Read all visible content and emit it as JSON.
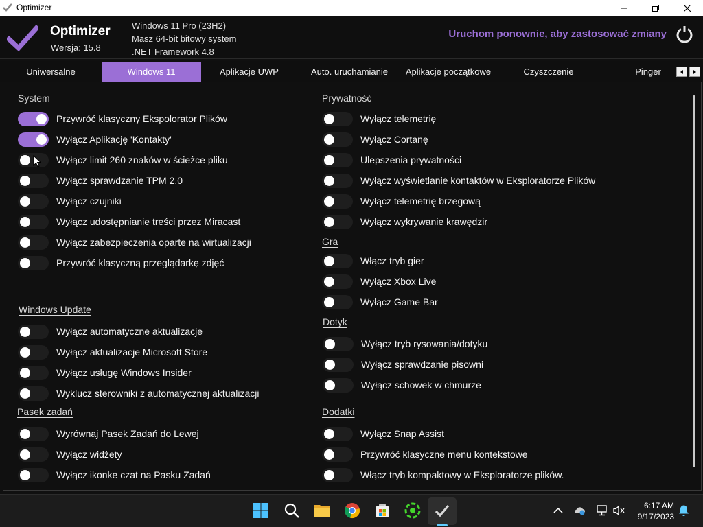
{
  "window": {
    "title": "Optimizer"
  },
  "header": {
    "app_name": "Optimizer",
    "version": "Wersja: 15.8",
    "sysinfo": [
      "Windows 11 Pro (23H2)",
      "Masz 64-bit bitowy system",
      ".NET Framework 4.8"
    ],
    "restart_text": "Uruchom ponownie, aby zastosować zmiany"
  },
  "tabs": [
    {
      "label": "Uniwersalne",
      "active": false
    },
    {
      "label": "Windows 11",
      "active": true
    },
    {
      "label": "Aplikacje UWP",
      "active": false
    },
    {
      "label": "Auto. uruchamianie",
      "active": false
    },
    {
      "label": "Aplikacje początkowe",
      "active": false
    },
    {
      "label": "Czyszczenie",
      "active": false
    },
    {
      "label": "Pinger",
      "active": false
    }
  ],
  "sections": {
    "system": {
      "title": "System",
      "items": [
        {
          "label": "Przywróć klasyczny Ekspolorator Plików",
          "on": true
        },
        {
          "label": "Wyłącz Aplikację 'Kontakty'",
          "on": true
        },
        {
          "label": "Wyłącz limit 260 znaków w ścieżce pliku",
          "on": false
        },
        {
          "label": "Wyłącz sprawdzanie TPM 2.0",
          "on": false
        },
        {
          "label": "Wyłącz czujniki",
          "on": false
        },
        {
          "label": "Wyłącz udostępnianie treści przez Miracast",
          "on": false
        },
        {
          "label": "Wyłącz zabezpieczenia oparte na wirtualizacji",
          "on": false
        },
        {
          "label": "Przywróć klasyczną przeglądarkę zdjęć",
          "on": false
        }
      ]
    },
    "windows_update": {
      "title": "Windows Update",
      "items": [
        {
          "label": "Wyłącz automatyczne aktualizacje",
          "on": false
        },
        {
          "label": "Wyłącz aktualizacje Microsoft Store",
          "on": false
        },
        {
          "label": "Wyłącz usługę Windows Insider",
          "on": false
        },
        {
          "label": "Wyklucz sterowniki z automatycznej aktualizacji",
          "on": false
        }
      ]
    },
    "taskbar": {
      "title": "Pasek zadań",
      "items": [
        {
          "label": "Wyrównaj Pasek Zadań do Lewej",
          "on": false
        },
        {
          "label": "Wyłącz widżety",
          "on": false
        },
        {
          "label": "Wyłącz ikonke czat na Pasku Zadań",
          "on": false
        }
      ]
    },
    "privacy": {
      "title": "Prywatność",
      "items": [
        {
          "label": "Wyłącz telemetrię",
          "on": false
        },
        {
          "label": "Wyłącz Cortanę",
          "on": false
        },
        {
          "label": "Ulepszenia prywatności",
          "on": false
        },
        {
          "label": "Wyłącz wyświetlanie kontaktów w Eksploratorze Plików",
          "on": false
        },
        {
          "label": "Wyłącz telemetrię brzegową",
          "on": false
        },
        {
          "label": "Wyłącz wykrywanie krawędzir",
          "on": false
        }
      ]
    },
    "game": {
      "title": "Gra",
      "items": [
        {
          "label": "Włącz tryb gier",
          "on": false
        },
        {
          "label": "Wyłącz Xbox Live",
          "on": false
        },
        {
          "label": "Wyłącz Game Bar",
          "on": false
        }
      ]
    },
    "touch": {
      "title": "Dotyk",
      "items": [
        {
          "label": "Wyłącz tryb rysowania/dotyku",
          "on": false
        },
        {
          "label": "Wyłącz sprawdzanie pisowni",
          "on": false
        },
        {
          "label": "Wyłącz schowek w chmurze",
          "on": false
        }
      ]
    },
    "extras": {
      "title": "Dodatki",
      "items": [
        {
          "label": "Wyłącz Snap Assist",
          "on": false
        },
        {
          "label": "Przywróć klasyczne menu kontekstowe",
          "on": false
        },
        {
          "label": "Włącz tryb kompaktowy w Eksploratorze plików.",
          "on": false
        }
      ]
    }
  },
  "taskbar_apps": [
    "windows-start-icon",
    "search-icon",
    "file-explorer-icon",
    "chrome-icon",
    "microsoft-store-icon",
    "razer-icon",
    "optimizer-icon"
  ],
  "clock": {
    "time": "6:17 AM",
    "date": "9/17/2023"
  },
  "colors": {
    "accent": "#9b6fd6",
    "background": "#101010",
    "toggle_off": "#1e1e1e"
  }
}
